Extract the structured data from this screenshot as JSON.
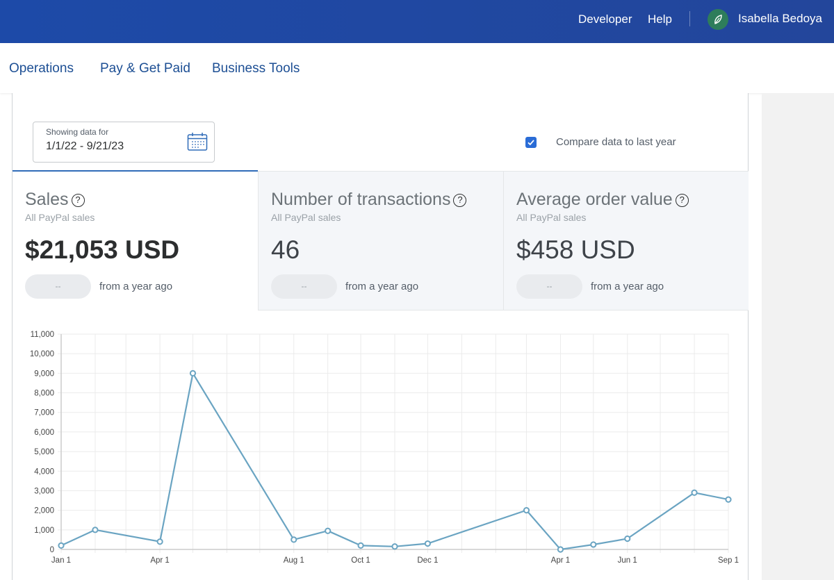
{
  "topbar": {
    "links": [
      "Developer",
      "Help"
    ],
    "user_name": "Isabella Bedoya"
  },
  "nav": {
    "items": [
      "Operations",
      "Pay & Get Paid",
      "Business Tools"
    ]
  },
  "filters": {
    "date_label": "Showing data for",
    "date_range": "1/1/22 - 9/21/23",
    "compare_checked": true,
    "compare_label": "Compare data to last year"
  },
  "metrics": [
    {
      "title": "Sales",
      "subtitle": "All PayPal sales",
      "value": "$21,053 USD",
      "change": "--",
      "change_label": "from a year ago",
      "active": true
    },
    {
      "title": "Number of transactions",
      "subtitle": "All PayPal sales",
      "value": "46",
      "change": "--",
      "change_label": "from a year ago",
      "active": false
    },
    {
      "title": "Average order value",
      "subtitle": "All PayPal sales",
      "value": "$458 USD",
      "change": "--",
      "change_label": "from a year ago",
      "active": false
    }
  ],
  "chart_data": {
    "type": "line",
    "title": "",
    "xlabel": "",
    "ylabel": "",
    "ylim": [
      0,
      11000
    ],
    "y_ticks": [
      0,
      1000,
      2000,
      3000,
      4000,
      5000,
      6000,
      7000,
      8000,
      9000,
      10000,
      11000
    ],
    "y_tick_labels": [
      "0",
      "1,000",
      "2,000",
      "3,000",
      "4,000",
      "5,000",
      "6,000",
      "7,000",
      "8,000",
      "9,000",
      "10,000",
      "11,000"
    ],
    "x_tick_labels": [
      "Jan 1",
      "Apr 1",
      "Aug 1",
      "Oct 1",
      "Dec 1",
      "Apr 1",
      "Jun 1",
      "Sep 1"
    ],
    "x_tick_dates": [
      "2022-01-01",
      "2022-04-01",
      "2022-08-01",
      "2022-10-01",
      "2022-12-01",
      "2023-04-01",
      "2023-06-01",
      "2023-09-01"
    ],
    "grid": true,
    "color": "#6aa4c2",
    "series": [
      {
        "points": [
          {
            "x": "2022-01-01",
            "y": 200
          },
          {
            "x": "2022-02-01",
            "y": 1000
          },
          {
            "x": "2022-04-01",
            "y": 400
          },
          {
            "x": "2022-05-01",
            "y": 9000
          },
          {
            "x": "2022-08-01",
            "y": 500
          },
          {
            "x": "2022-09-01",
            "y": 950
          },
          {
            "x": "2022-10-01",
            "y": 200
          },
          {
            "x": "2022-11-01",
            "y": 150
          },
          {
            "x": "2022-12-01",
            "y": 300
          },
          {
            "x": "2023-03-01",
            "y": 2000
          },
          {
            "x": "2023-04-01",
            "y": 0
          },
          {
            "x": "2023-05-01",
            "y": 250
          },
          {
            "x": "2023-06-01",
            "y": 550
          },
          {
            "x": "2023-08-01",
            "y": 2900
          },
          {
            "x": "2023-09-01",
            "y": 2550
          }
        ]
      }
    ]
  }
}
